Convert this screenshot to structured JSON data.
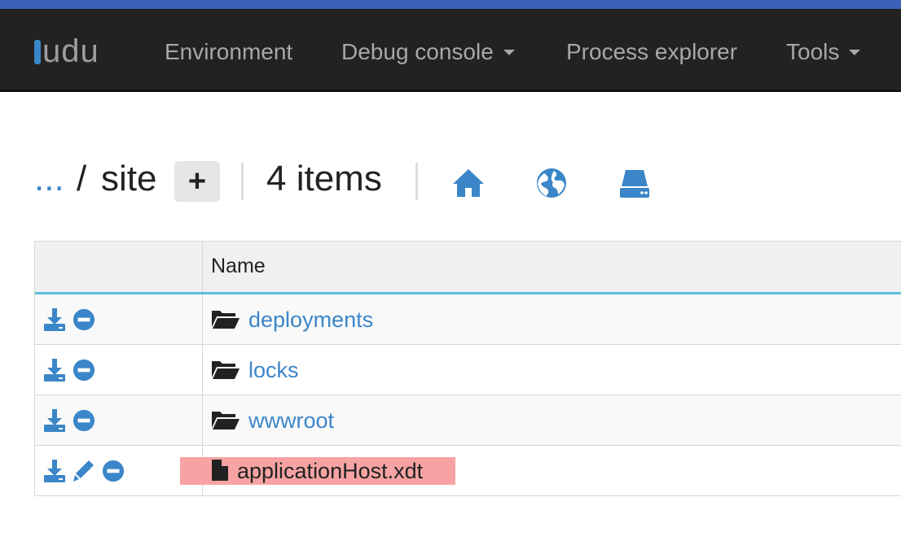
{
  "app": {
    "brand": "udu",
    "brand_color": "#3a86c8",
    "accent_bar_color": "#3b62b8"
  },
  "navbar": {
    "items": [
      {
        "label": "Environment",
        "dropdown": false
      },
      {
        "label": "Debug console",
        "dropdown": true
      },
      {
        "label": "Process explorer",
        "dropdown": false
      },
      {
        "label": "Tools",
        "dropdown": true
      }
    ]
  },
  "breadcrumb": {
    "ellipsis": "...",
    "separator": "/",
    "current": "site",
    "add_label": "+",
    "items_count": "4 items",
    "icons": [
      "home-icon",
      "globe-icon",
      "drive-icon"
    ]
  },
  "table": {
    "headers": [
      "",
      "Name"
    ],
    "rows": [
      {
        "name": "deployments",
        "type": "folder",
        "actions": [
          "download-icon",
          "remove-icon"
        ]
      },
      {
        "name": "locks",
        "type": "folder",
        "actions": [
          "download-icon",
          "remove-icon"
        ]
      },
      {
        "name": "wwwroot",
        "type": "folder",
        "actions": [
          "download-icon",
          "remove-icon"
        ]
      },
      {
        "name": "applicationHost.xdt",
        "type": "file",
        "highlighted": true,
        "actions": [
          "download-icon",
          "edit-icon",
          "remove-icon"
        ]
      }
    ]
  }
}
